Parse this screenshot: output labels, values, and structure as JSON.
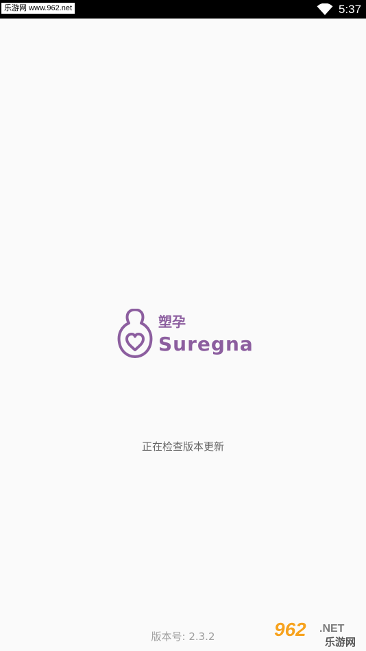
{
  "status_bar": {
    "site_tag": "乐游网 www.962.net",
    "time": "5:37",
    "wifi_icon": "wifi-icon"
  },
  "logo": {
    "chinese_name": "塑孕",
    "english_name": "Suregna",
    "mark_icon": "pear-heart-logo-icon",
    "color": "#8c5e9f"
  },
  "loading": {
    "status_text": "正在检查版本更新"
  },
  "footer": {
    "version_label": "版本号: 2.3.2"
  },
  "watermark": {
    "brand_digits": "962",
    "brand_suffix": ".NET",
    "brand_cn": "乐游网"
  }
}
